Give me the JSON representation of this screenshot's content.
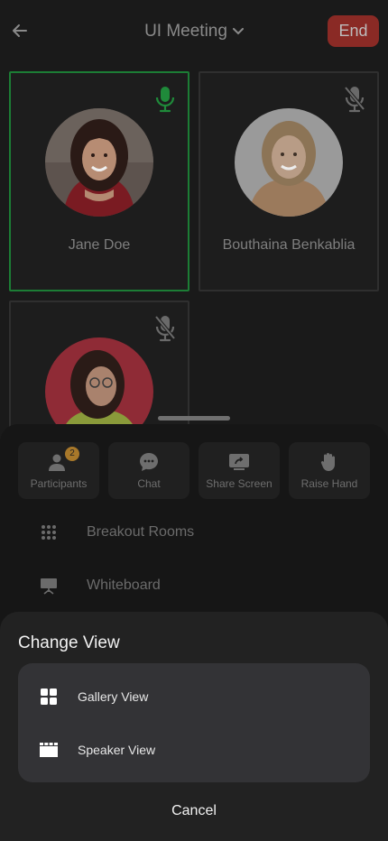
{
  "header": {
    "title": "UI Meeting",
    "end_label": "End"
  },
  "participants": [
    {
      "name": "Jane Doe",
      "mic": "on"
    },
    {
      "name": "Bouthaina Benkablia",
      "mic": "muted"
    },
    {
      "name": "",
      "mic": "muted"
    }
  ],
  "actions": [
    {
      "label": "Participants",
      "icon": "participants-icon",
      "badge": "2"
    },
    {
      "label": "Chat",
      "icon": "chat-icon"
    },
    {
      "label": "Share Screen",
      "icon": "share-screen-icon"
    },
    {
      "label": "Raise Hand",
      "icon": "raise-hand-icon"
    }
  ],
  "menu": [
    {
      "label": "Breakout Rooms",
      "icon": "breakout-rooms-icon"
    },
    {
      "label": "Whiteboard",
      "icon": "whiteboard-icon"
    }
  ],
  "change_view": {
    "title": "Change View",
    "options": [
      {
        "label": "Gallery View",
        "icon": "gallery-view-icon"
      },
      {
        "label": "Speaker View",
        "icon": "speaker-view-icon"
      }
    ],
    "cancel_label": "Cancel"
  },
  "colors": {
    "active_border": "#1c7d35",
    "mic_on": "#1f8a3a",
    "end_button": "#8a2a25",
    "badge": "#a8782a"
  }
}
